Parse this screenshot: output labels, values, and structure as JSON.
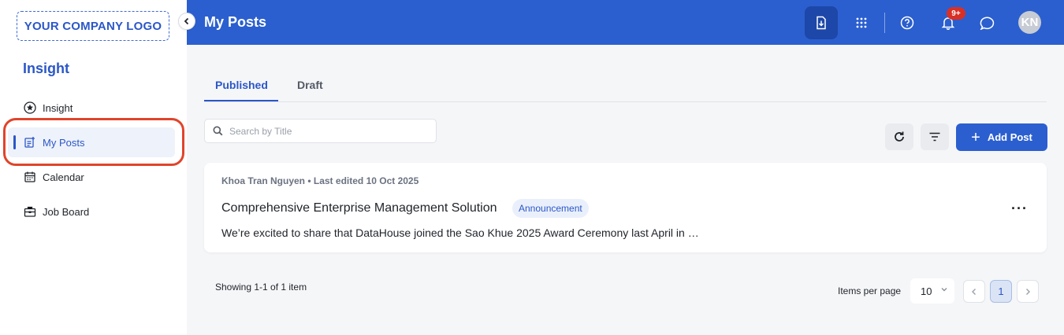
{
  "brand": {
    "logo_text": "YOUR COMPANY LOGO",
    "accent": "#2b5fcf"
  },
  "sidebar": {
    "section_title": "Insight",
    "items": [
      {
        "label": "Insight",
        "icon": "star-circle-icon"
      },
      {
        "label": "My Posts",
        "icon": "post-edit-icon",
        "active": true
      },
      {
        "label": "Calendar",
        "icon": "calendar-icon"
      },
      {
        "label": "Job Board",
        "icon": "briefcase-icon"
      }
    ]
  },
  "topbar": {
    "title": "My Posts",
    "notification_badge": "9+",
    "avatar_initials": "KN"
  },
  "tabs": [
    {
      "label": "Published",
      "active": true
    },
    {
      "label": "Draft",
      "active": false
    }
  ],
  "search": {
    "placeholder": "Search by Title",
    "value": ""
  },
  "toolbar": {
    "add_label": "Add Post"
  },
  "posts": [
    {
      "meta": "Khoa Tran Nguyen • Last edited 10 Oct 2025",
      "title": "Comprehensive Enterprise Management Solution",
      "tag": "Announcement",
      "excerpt": "We’re excited to share that DataHouse joined the Sao Khue 2025 Award Ceremony last April in …",
      "more": "···"
    }
  ],
  "pagination": {
    "showing": "Showing 1-1 of 1 item",
    "items_per_page_label": "Items per page",
    "items_per_page": "10",
    "current_page": "1"
  }
}
